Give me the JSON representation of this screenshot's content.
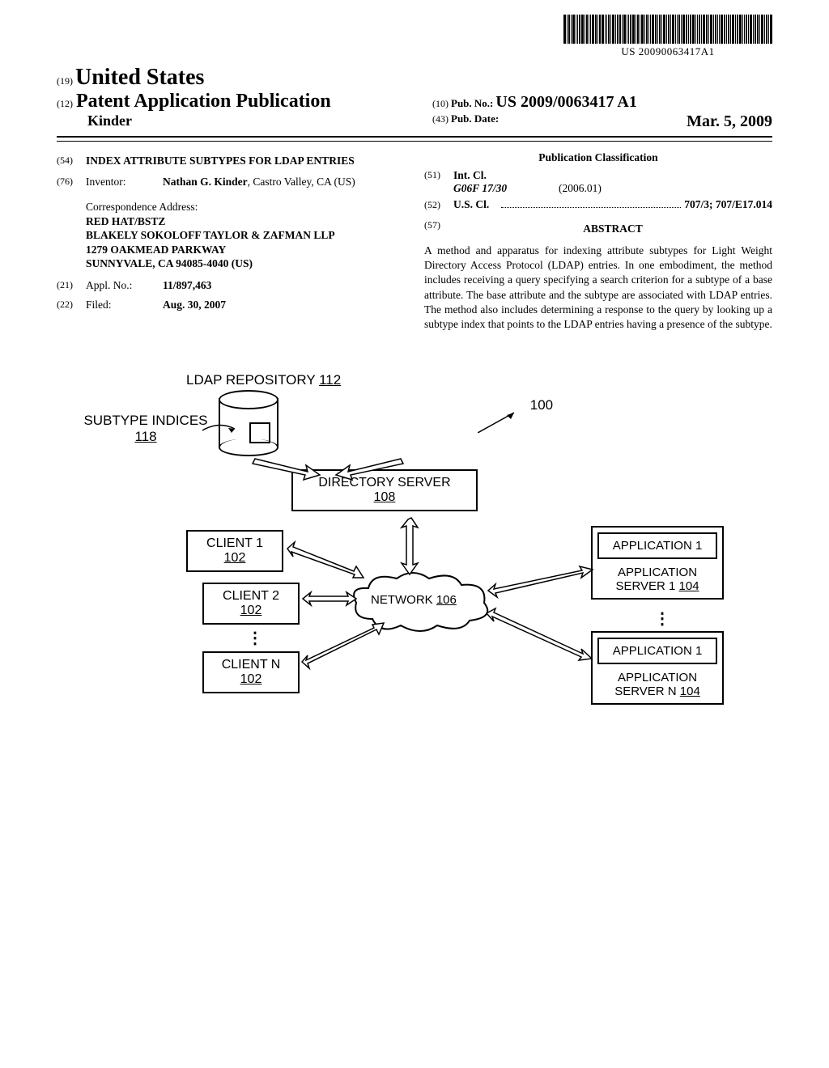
{
  "barcode_text": "US 20090063417A1",
  "header": {
    "num19": "(19)",
    "country": "United States",
    "num12": "(12)",
    "kind": "Patent Application Publication",
    "author": "Kinder",
    "num10": "(10)",
    "pubno_label": "Pub. No.:",
    "pubno": "US 2009/0063417 A1",
    "num43": "(43)",
    "pubdate_label": "Pub. Date:",
    "pubdate": "Mar. 5, 2009"
  },
  "left": {
    "num54": "(54)",
    "title": "INDEX ATTRIBUTE SUBTYPES FOR LDAP ENTRIES",
    "num76": "(76)",
    "inventor_label": "Inventor:",
    "inventor": "Nathan G. Kinder",
    "inventor_loc": ", Castro Valley, CA (US)",
    "corr_label": "Correspondence Address:",
    "corr1": "RED HAT/BSTZ",
    "corr2": "BLAKELY SOKOLOFF TAYLOR & ZAFMAN LLP",
    "corr3": "1279 OAKMEAD PARKWAY",
    "corr4": "SUNNYVALE, CA 94085-4040 (US)",
    "num21": "(21)",
    "appl_label": "Appl. No.:",
    "appl": "11/897,463",
    "num22": "(22)",
    "filed_label": "Filed:",
    "filed": "Aug. 30, 2007"
  },
  "right": {
    "pubclass": "Publication Classification",
    "num51": "(51)",
    "intcl_label": "Int. Cl.",
    "intcl_code": "G06F 17/30",
    "intcl_date": "(2006.01)",
    "num52": "(52)",
    "uscl_label": "U.S. Cl.",
    "uscl_val": "707/3; 707/E17.014",
    "num57": "(57)",
    "abstract_label": "ABSTRACT",
    "abstract": "A method and apparatus for indexing attribute subtypes for Light Weight Directory Access Protocol (LDAP) entries. In one embodiment, the method includes receiving a query specifying a search criterion for a subtype of a base attribute. The base attribute and the subtype are associated with LDAP entries. The method also includes determining a response to the query by looking up a subtype index that points to the LDAP entries having a presence of the subtype."
  },
  "diagram": {
    "repo": "LDAP REPOSITORY ",
    "repo_num": "112",
    "subidx": "SUBTYPE INDICES",
    "subidx_num": "118",
    "sysnum": "100",
    "dirsrv": "DIRECTORY SERVER",
    "dirsrv_num": "108",
    "client1": "CLIENT 1",
    "client2": "CLIENT 2",
    "clientn": "CLIENT N",
    "client_num": "102",
    "network": "NETWORK ",
    "network_num": "106",
    "app1": "APPLICATION 1",
    "appsrv1": "APPLICATION SERVER 1 ",
    "appsrv1_num": "104",
    "appsrvn": "APPLICATION SERVER N ",
    "appsrvn_num": "104"
  }
}
